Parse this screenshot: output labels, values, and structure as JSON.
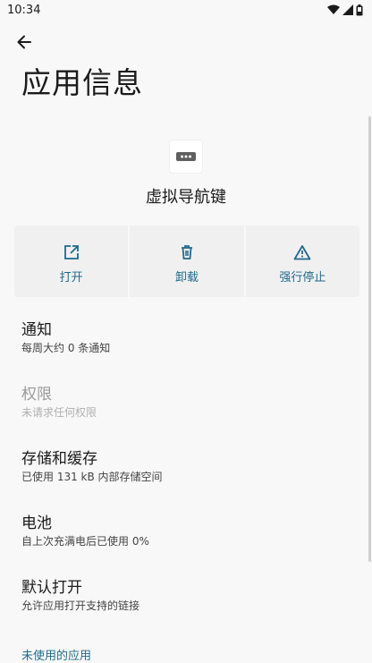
{
  "status_bar": {
    "time": "10:34",
    "icons": [
      "wifi-icon",
      "signal-icon",
      "battery-icon"
    ]
  },
  "header": {
    "back_icon": "arrow-left-icon",
    "title": "应用信息"
  },
  "app": {
    "icon": "navigation-keys-app-icon",
    "name": "虚拟导航键"
  },
  "actions": [
    {
      "label": "打开",
      "icon": "open-external-icon"
    },
    {
      "label": "卸载",
      "icon": "trash-icon"
    },
    {
      "label": "强行停止",
      "icon": "warning-icon"
    }
  ],
  "settings": [
    {
      "title": "通知",
      "summary": "每周大约 0 条通知",
      "enabled": true
    },
    {
      "title": "权限",
      "summary": "未请求任何权限",
      "enabled": false
    },
    {
      "title": "存储和缓存",
      "summary": "已使用 131 kB 内部存储空间",
      "enabled": true
    },
    {
      "title": "电池",
      "summary": "自上次充满电后已使用 0%",
      "enabled": true
    },
    {
      "title": "默认打开",
      "summary": "允许应用打开支持的链接",
      "enabled": true
    }
  ],
  "next_section": "未使用的应用",
  "colors": {
    "accent": "#1f6a8a",
    "background": "#f8f8f8",
    "action_background": "#f0f0f0",
    "disabled_text": "#9a9a9a"
  }
}
